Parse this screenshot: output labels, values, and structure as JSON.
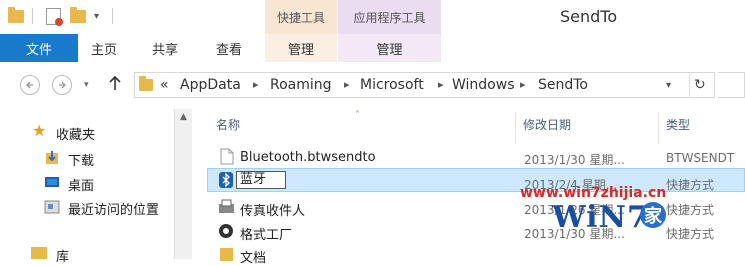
{
  "title": "SendTo",
  "context_tabs": {
    "tools": "快捷工具",
    "app_tools": "应用程序工具"
  },
  "ribbon_tabs": {
    "file": "文件",
    "home": "主页",
    "share": "共享",
    "view": "查看",
    "manage1": "管理",
    "manage2": "管理"
  },
  "address": {
    "overflow": "«",
    "crumbs": [
      "AppData",
      "Roaming",
      "Microsoft",
      "Windows",
      "SendTo"
    ]
  },
  "nav": {
    "favorites": "收藏夹",
    "downloads": "下载",
    "desktop": "桌面",
    "recent": "最近访问的位置",
    "libraries": "库"
  },
  "columns": {
    "name": "名称",
    "date": "修改日期",
    "type": "类型"
  },
  "files": [
    {
      "name": "Bluetooth.btwsendto",
      "date": "2013/1/30 星期...",
      "type": "BTWSENDT"
    },
    {
      "name": "蓝牙",
      "date": "2013/2/4 星期...",
      "type": "快捷方式"
    },
    {
      "name": "传真收件人",
      "date": "2013/1/26 星期...",
      "type": "快捷方式"
    },
    {
      "name": "格式工厂",
      "date": "2013/1/30 星期...",
      "type": "快捷方式"
    },
    {
      "name": "文档",
      "date": "",
      "type": ""
    }
  ],
  "watermark": {
    "url": "www.win7zhijia.cn",
    "logo": "WiN7.",
    "char": "家"
  },
  "colors": {
    "file_tab": "#1979ca",
    "selection": "#cde8ff",
    "context_tools": "#f9e6d2",
    "context_app": "#eadcf1"
  }
}
